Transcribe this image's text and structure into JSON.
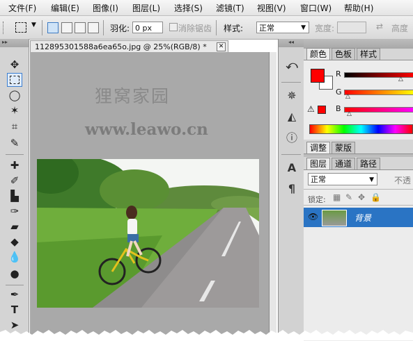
{
  "menubar": {
    "items": [
      "文件(F)",
      "编辑(E)",
      "图像(I)",
      "图层(L)",
      "选择(S)",
      "滤镜(T)",
      "视图(V)",
      "窗口(W)",
      "帮助(H)"
    ]
  },
  "options": {
    "feather_label": "羽化:",
    "feather_value": "0 px",
    "antialias_label": "消除锯齿",
    "style_label": "样式:",
    "style_value": "正常",
    "width_label": "宽度:",
    "height_label": "高度"
  },
  "document": {
    "tab_title": "112895301588a6ea65o.jpg @ 25%(RGB/8) *",
    "watermark_cn": "狸窝家园",
    "watermark_url": "www.leawo.cn"
  },
  "color_panel": {
    "tabs": [
      "颜色",
      "色板",
      "样式"
    ],
    "channels": [
      {
        "name": "R",
        "value": 0.83
      },
      {
        "name": "G",
        "value": 0.04
      },
      {
        "name": "B",
        "value": 0.07
      }
    ],
    "foreground": "#ff0000",
    "background": "#ffffff"
  },
  "adjust_panel": {
    "tabs": [
      "调整",
      "蒙版"
    ]
  },
  "layers_panel": {
    "tabs": [
      "图层",
      "通道",
      "路径"
    ],
    "blend_mode": "正常",
    "opacity_label": "不透",
    "lock_label": "锁定:",
    "layer_name": "背景"
  },
  "colors": {
    "accent": "#2a74c4",
    "canvas_gray": "#a9a9a9"
  }
}
